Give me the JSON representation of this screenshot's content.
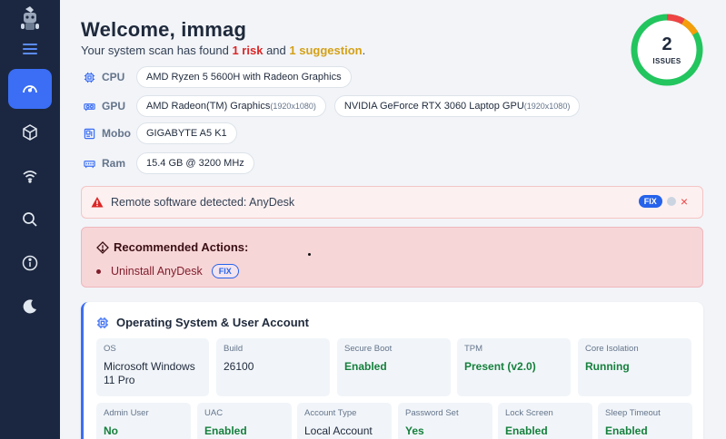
{
  "app": {
    "logo_icon": "robot-mascot-icon"
  },
  "sidebar": {
    "items": [
      {
        "name": "dashboard",
        "icon": "gauge-icon",
        "active": true
      },
      {
        "name": "apps",
        "icon": "cube-icon",
        "active": false
      },
      {
        "name": "network",
        "icon": "wifi-icon",
        "active": false
      },
      {
        "name": "search",
        "icon": "search-icon",
        "active": false
      },
      {
        "name": "info",
        "icon": "info-icon",
        "active": false
      },
      {
        "name": "theme",
        "icon": "moon-icon",
        "active": false
      }
    ]
  },
  "header": {
    "title": "Welcome, immag",
    "subtitle_prefix": "Your system scan has found",
    "risk_text": "1 risk",
    "and_text": "and",
    "suggestion_text": "1 suggestion",
    "period": "."
  },
  "hardware": {
    "cpu_label": "CPU",
    "cpu_value": "AMD Ryzen 5 5600H with Radeon Graphics",
    "gpu_label": "GPU",
    "gpu1_name": "AMD Radeon(TM) Graphics",
    "gpu1_res": "(1920x1080)",
    "gpu2_name": "NVIDIA GeForce RTX 3060 Laptop GPU",
    "gpu2_res": "(1920x1080)",
    "mobo_label": "Mobo",
    "mobo_value": "GIGABYTE A5 K1",
    "ram_label": "Ram",
    "ram_value": "15.4 GB @ 3200 MHz"
  },
  "issues": {
    "count": "2",
    "label": "ISSUES",
    "risk_fraction": 0.083,
    "suggestion_fraction": 0.083,
    "colors": {
      "ok": "#22c55e",
      "risk": "#ef4444",
      "suggestion": "#f59e0b"
    }
  },
  "alert": {
    "text": "Remote software detected: AnyDesk",
    "fix_label": "FIX",
    "close_glyph": "×"
  },
  "recommended": {
    "title": "Recommended Actions:",
    "item": "Uninstall AnyDesk",
    "fix_label": "FIX"
  },
  "os_card": {
    "title": "Operating System & User Account",
    "row1": [
      {
        "label": "OS",
        "value": "Microsoft Windows 11 Pro"
      },
      {
        "label": "Build",
        "value": "26100"
      },
      {
        "label": "Secure Boot",
        "value": "Enabled"
      },
      {
        "label": "TPM",
        "value": "Present (v2.0)"
      },
      {
        "label": "Core Isolation",
        "value": "Running"
      }
    ],
    "row2": [
      {
        "label": "Admin User",
        "value": "No"
      },
      {
        "label": "UAC",
        "value": "Enabled"
      },
      {
        "label": "Account Type",
        "value": "Local Account"
      },
      {
        "label": "Password Set",
        "value": "Yes"
      },
      {
        "label": "Lock Screen",
        "value": "Enabled"
      },
      {
        "label": "Sleep Timeout",
        "value": "Enabled"
      }
    ]
  }
}
